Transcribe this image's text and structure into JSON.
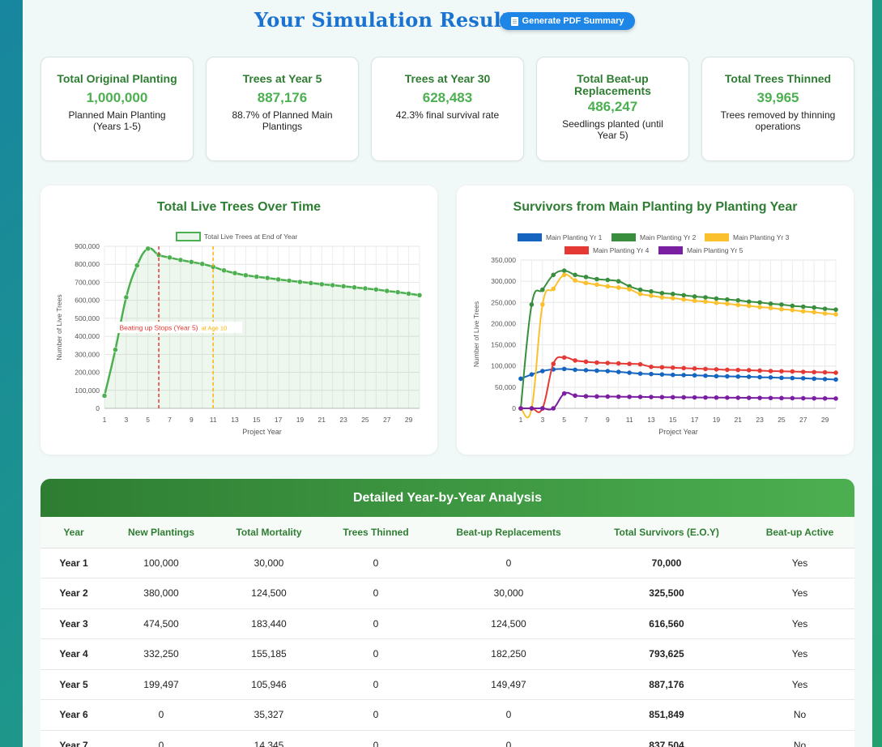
{
  "header": {
    "title": "Your Simulation Results",
    "pdf_button": "Generate PDF Summary"
  },
  "stats": [
    {
      "title": "Total Original Planting",
      "value": "1,000,000",
      "sub": "Planned Main Planting (Years 1-5)"
    },
    {
      "title": "Trees at Year 5",
      "value": "887,176",
      "sub": "88.7% of Planned Main Plantings"
    },
    {
      "title": "Trees at Year 30",
      "value": "628,483",
      "sub": "42.3% final survival rate"
    },
    {
      "title": "Total Beat-up Replacements",
      "value": "486,247",
      "sub": "Seedlings planted (until Year 5)"
    },
    {
      "title": "Total Trees Thinned",
      "value": "39,965",
      "sub": "Trees removed by thinning operations"
    }
  ],
  "chart_data": [
    {
      "type": "area",
      "title": "Total Live Trees Over Time",
      "xlabel": "Project Year",
      "ylabel": "Number of Live Trees",
      "ylim": [
        0,
        900000
      ],
      "yticks": [
        "0",
        "100,000",
        "200,000",
        "300,000",
        "400,000",
        "500,000",
        "600,000",
        "700,000",
        "800,000",
        "900,000"
      ],
      "xticks": [
        "1",
        "3",
        "5",
        "7",
        "9",
        "11",
        "13",
        "15",
        "17",
        "19",
        "21",
        "23",
        "25",
        "27",
        "29"
      ],
      "legend": "top",
      "grid": true,
      "color": "#4caf50",
      "series": [
        {
          "name": "Total Live Trees at End of Year",
          "x": [
            1,
            2,
            3,
            4,
            5,
            6,
            7,
            8,
            9,
            10,
            11,
            12,
            13,
            14,
            15,
            16,
            17,
            18,
            19,
            20,
            21,
            22,
            23,
            24,
            25,
            26,
            27,
            28,
            29,
            30
          ],
          "values": [
            70000,
            325500,
            616560,
            793625,
            887176,
            851849,
            837504,
            824000,
            813000,
            802000,
            786000,
            766000,
            751000,
            739000,
            731000,
            724000,
            716000,
            709000,
            702000,
            696000,
            689000,
            684000,
            678000,
            672000,
            666000,
            660000,
            652000,
            645000,
            637000,
            628483
          ]
        }
      ],
      "annotations": [
        {
          "label": "Beating up Stops (Year 5)",
          "x": 6,
          "color": "#e53935"
        },
        {
          "label": "Thinning at Age 10",
          "x": 11,
          "color": "#ffb300"
        }
      ]
    },
    {
      "type": "line",
      "title": "Survivors from Main Planting by Planting Year",
      "xlabel": "Project Year",
      "ylabel": "Number of Live Trees",
      "ylim": [
        0,
        350000
      ],
      "yticks": [
        "0",
        "50,000",
        "100,000",
        "150,000",
        "200,000",
        "250,000",
        "300,000",
        "350,000"
      ],
      "xticks": [
        "1",
        "3",
        "5",
        "7",
        "9",
        "11",
        "13",
        "15",
        "17",
        "19",
        "21",
        "23",
        "25",
        "27",
        "29"
      ],
      "legend": "top",
      "grid": true,
      "series": [
        {
          "name": "Main Planting Yr 1",
          "color": "#1565c0",
          "values": [
            70000,
            80000,
            88000,
            92000,
            93000,
            91000,
            90000,
            89000,
            88000,
            86000,
            84000,
            82000,
            81000,
            80000,
            79000,
            78500,
            78000,
            77000,
            76000,
            75500,
            75000,
            74500,
            73500,
            73000,
            72000,
            71500,
            71000,
            70000,
            69000,
            68000
          ]
        },
        {
          "name": "Main Planting Yr 2",
          "color": "#388e3c",
          "values": [
            0,
            245000,
            280000,
            315000,
            325000,
            315000,
            310000,
            305000,
            303000,
            300000,
            288000,
            280000,
            276000,
            272000,
            270000,
            267000,
            264000,
            262000,
            259000,
            257000,
            255000,
            252000,
            250000,
            247000,
            245000,
            242000,
            240000,
            238000,
            235000,
            233000
          ]
        },
        {
          "name": "Main Planting Yr 3",
          "color": "#fbc02d",
          "values": [
            0,
            0,
            245000,
            282000,
            315000,
            302000,
            296000,
            292000,
            288000,
            285000,
            281000,
            270000,
            266000,
            262000,
            260000,
            257000,
            254000,
            252000,
            249000,
            247000,
            244000,
            242000,
            239000,
            237000,
            234000,
            232000,
            229000,
            227000,
            224000,
            222000
          ]
        },
        {
          "name": "Main Planting Yr 4",
          "color": "#e53935",
          "values": [
            0,
            0,
            0,
            105000,
            120000,
            113000,
            110000,
            108000,
            107000,
            106000,
            105000,
            104000,
            98000,
            97000,
            96000,
            95000,
            94000,
            93000,
            92000,
            91000,
            90500,
            90000,
            89000,
            88000,
            87500,
            87000,
            86000,
            85500,
            85000,
            84000
          ]
        },
        {
          "name": "Main Planting Yr 5",
          "color": "#7b1fa2",
          "values": [
            0,
            0,
            0,
            0,
            35000,
            30000,
            28500,
            28000,
            27800,
            27500,
            27200,
            27000,
            26700,
            26400,
            26200,
            26000,
            25800,
            25600,
            25400,
            25200,
            25000,
            24800,
            24600,
            24400,
            24200,
            24000,
            23800,
            23600,
            23400,
            23200
          ]
        }
      ]
    }
  ],
  "table": {
    "heading": "Detailed Year-by-Year Analysis",
    "columns": [
      "Year",
      "New Plantings",
      "Total Mortality",
      "Trees Thinned",
      "Beat-up Replacements",
      "Total Survivors (E.O.Y)",
      "Beat-up Active"
    ],
    "rows": [
      [
        "Year 1",
        "100,000",
        "30,000",
        "0",
        "0",
        "70,000",
        "Yes"
      ],
      [
        "Year 2",
        "380,000",
        "124,500",
        "0",
        "30,000",
        "325,500",
        "Yes"
      ],
      [
        "Year 3",
        "474,500",
        "183,440",
        "0",
        "124,500",
        "616,560",
        "Yes"
      ],
      [
        "Year 4",
        "332,250",
        "155,185",
        "0",
        "182,250",
        "793,625",
        "Yes"
      ],
      [
        "Year 5",
        "199,497",
        "105,946",
        "0",
        "149,497",
        "887,176",
        "Yes"
      ],
      [
        "Year 6",
        "0",
        "35,327",
        "0",
        "0",
        "851,849",
        "No"
      ],
      [
        "Year 7",
        "0",
        "14,345",
        "0",
        "0",
        "837,504",
        "No"
      ]
    ]
  }
}
